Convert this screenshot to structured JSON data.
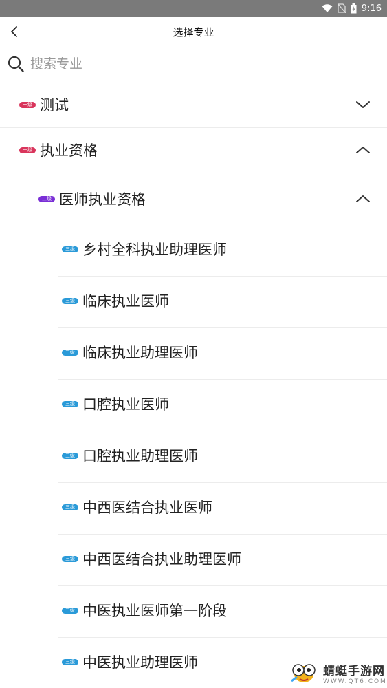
{
  "status_bar": {
    "time": "9:16"
  },
  "header": {
    "title": "选择专业"
  },
  "search": {
    "placeholder": "搜索专业"
  },
  "level_badges": {
    "level1": "一级",
    "level2": "二级",
    "level3": "三级"
  },
  "categories": [
    {
      "label": "测试",
      "expanded": false
    },
    {
      "label": "执业资格",
      "expanded": true,
      "children": [
        {
          "label": "医师执业资格",
          "expanded": true,
          "children": [
            "乡村全科执业助理医师",
            "临床执业医师",
            "临床执业助理医师",
            "口腔执业医师",
            "口腔执业助理医师",
            "中西医结合执业医师",
            "中西医结合执业助理医师",
            "中医执业医师第一阶段",
            "中医执业助理医师"
          ]
        }
      ]
    }
  ],
  "watermark": {
    "name": "蜻蜓手游网",
    "url": "WWW.QT6.COM"
  },
  "colors": {
    "level1": "#d9355c",
    "level2": "#7a2fd6",
    "level3": "#2a9ad8",
    "status_bar": "#7a7a7a"
  }
}
